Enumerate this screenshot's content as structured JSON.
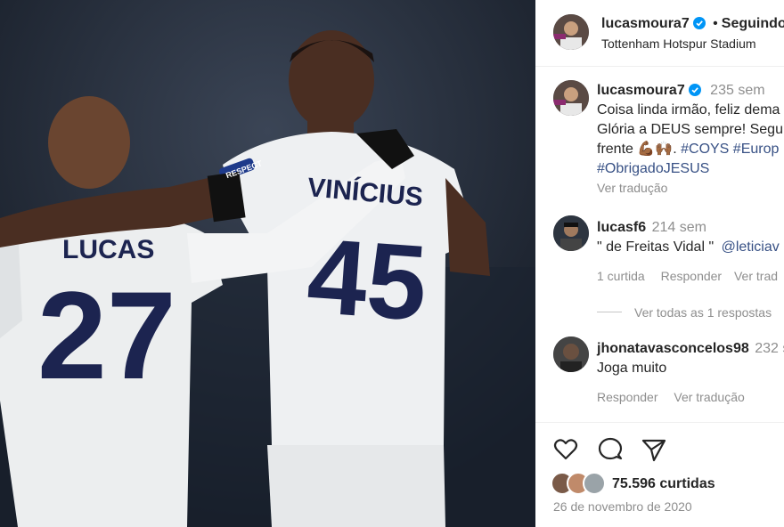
{
  "header": {
    "username": "lucasmoura7",
    "separator": "•",
    "follow_state": "Seguindo",
    "location": "Tottenham Hotspur Stadium"
  },
  "caption": {
    "username": "lucasmoura7",
    "time": "235 sem",
    "line1": "Coisa linda irmão, feliz dema",
    "line2": "Glória a DEUS sempre! Segu",
    "line3_text": "frente 💪🏾🙌🏾.",
    "line3_tags": "#COYS #Europ",
    "line4_tag": "#ObrigadoJESUS",
    "translate": "Ver tradução"
  },
  "comments": [
    {
      "username": "lucasf6",
      "time": "214 sem",
      "text": "\" de Freitas Vidal \"",
      "mention": "@leticiav",
      "likes": "1 curtida",
      "reply": "Responder",
      "translate": "Ver trad",
      "view_replies": "Ver todas as 1 respostas"
    },
    {
      "username": "jhonatavasconcelos98",
      "time": "232 s",
      "text": "Joga muito",
      "reply": "Responder",
      "translate": "Ver tradução"
    }
  ],
  "actions": {
    "like_icon": "heart-icon",
    "comment_icon": "comment-icon",
    "share_icon": "send-icon",
    "likes_count": "75.596 curtidas",
    "date": "26 de novembro de 2020"
  },
  "photo": {
    "player_left_name": "LUCAS",
    "player_left_number": "27",
    "player_right_name": "VINÍCIUS",
    "player_right_number": "45",
    "sleeve_patch": "RESPECT"
  },
  "colors": {
    "accent": "#0095f6",
    "link": "#385185",
    "muted": "#8e8e8e",
    "kit_navy": "#1c2450"
  }
}
